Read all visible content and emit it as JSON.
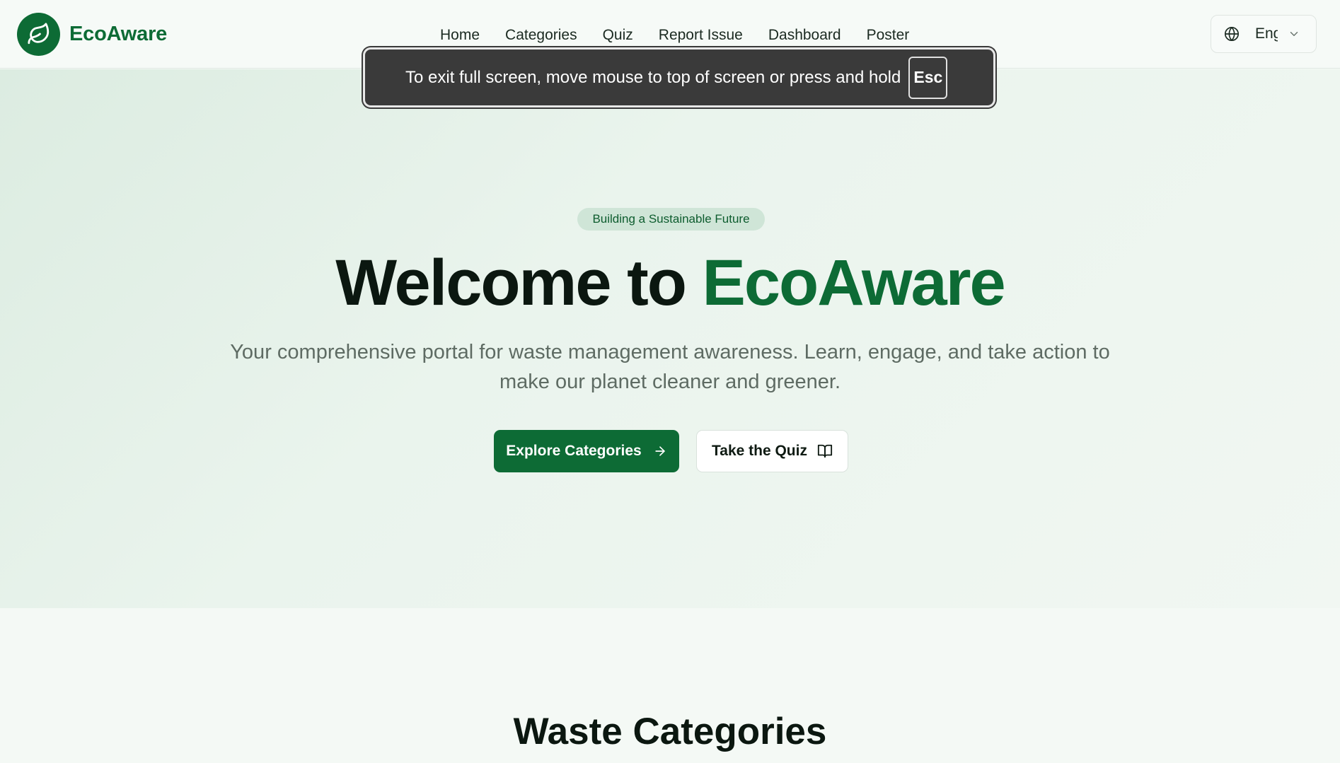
{
  "brand": {
    "name": "EcoAware"
  },
  "nav": {
    "items": [
      {
        "label": "Home"
      },
      {
        "label": "Categories"
      },
      {
        "label": "Quiz"
      },
      {
        "label": "Report Issue"
      },
      {
        "label": "Dashboard"
      },
      {
        "label": "Poster"
      }
    ]
  },
  "language": {
    "selected": "Eng"
  },
  "fullscreen_toast": {
    "message": "To exit full screen, move mouse to top of screen or press and hold",
    "key": "Esc"
  },
  "hero": {
    "badge": "Building a Sustainable Future",
    "title_prefix": "Welcome to ",
    "title_accent": "EcoAware",
    "subtitle": "Your comprehensive portal for waste management awareness. Learn, engage, and take action to make our planet cleaner and greener.",
    "primary_button": "Explore Categories",
    "secondary_button": "Take the Quiz"
  },
  "categories_section": {
    "title": "Waste Categories"
  },
  "colors": {
    "brand_green": "#0d6b35",
    "badge_bg": "#cfe5d7",
    "toast_bg": "#3a3a3a"
  },
  "icons": {
    "logo": "leaf-icon",
    "language": "globe-icon",
    "dropdown": "chevron-down-icon",
    "primary_button": "arrow-right-icon",
    "secondary_button": "book-open-icon"
  }
}
